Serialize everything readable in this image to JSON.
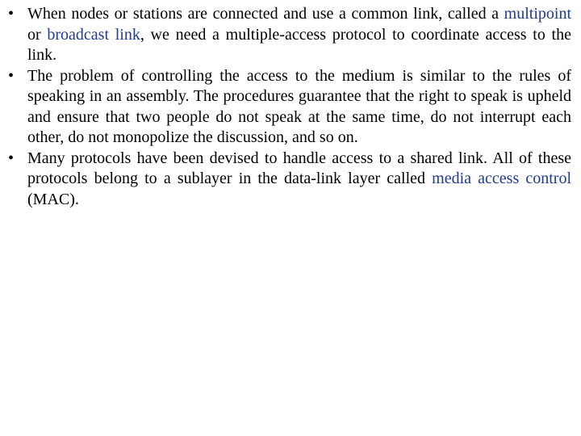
{
  "bullets": [
    {
      "segments": [
        {
          "text": "When nodes or stations are connected and use a common link, called a ",
          "highlight": false
        },
        {
          "text": "multipoint",
          "highlight": true
        },
        {
          "text": " or ",
          "highlight": false
        },
        {
          "text": "broadcast link",
          "highlight": true
        },
        {
          "text": ", we need a multiple-access protocol to coordinate access to the link.",
          "highlight": false
        }
      ]
    },
    {
      "segments": [
        {
          "text": "The problem of controlling the access to the medium is similar to the rules of speaking in an assembly. The procedures guarantee that the right to speak is upheld and ensure that two people do not speak at the same time, do not interrupt each other, do not monopolize the discussion, and so on.",
          "highlight": false
        }
      ]
    },
    {
      "segments": [
        {
          "text": "Many protocols have been devised to handle access to a shared link. All of these protocols belong to a sublayer in the data-link layer called ",
          "highlight": false
        },
        {
          "text": "media access control",
          "highlight": true
        },
        {
          "text": " (MAC).",
          "highlight": false
        }
      ]
    }
  ],
  "bullet_glyph": "•",
  "colors": {
    "highlight": "#1f3b8a",
    "text": "#000000"
  }
}
